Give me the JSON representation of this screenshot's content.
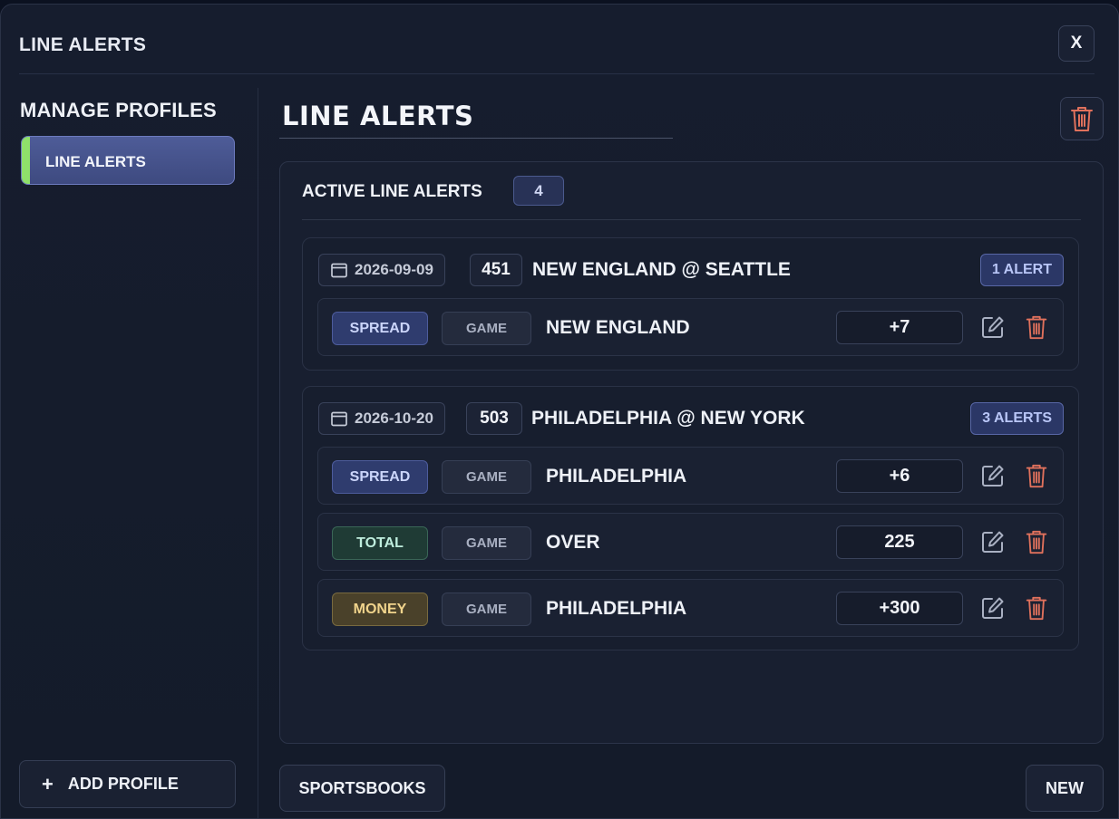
{
  "window": {
    "title": "LINE ALERTS",
    "close_label": "X"
  },
  "sidebar": {
    "title": "MANAGE PROFILES",
    "profiles": [
      {
        "label": "LINE ALERTS",
        "selected": true
      }
    ],
    "add_profile_label": "ADD PROFILE",
    "add_profile_icon": "+"
  },
  "main": {
    "profile_name": "LINE ALERTS",
    "panel": {
      "header_label": "ACTIVE LINE ALERTS",
      "active_count": "4"
    },
    "games": [
      {
        "date": "2026-09-09",
        "number": "451",
        "matchup": "NEW ENGLAND @ SEATTLE",
        "alert_count": "1 ALERT",
        "alerts": [
          {
            "type": "SPREAD",
            "scope": "GAME",
            "selection": "NEW ENGLAND",
            "line": "+7"
          }
        ]
      },
      {
        "date": "2026-10-20",
        "number": "503",
        "matchup": "PHILADELPHIA @ NEW YORK",
        "alert_count": "3 ALERTS",
        "alerts": [
          {
            "type": "SPREAD",
            "scope": "GAME",
            "selection": "PHILADELPHIA",
            "line": "+6"
          },
          {
            "type": "TOTAL",
            "scope": "GAME",
            "selection": "OVER",
            "line": "225"
          },
          {
            "type": "MONEY",
            "scope": "GAME",
            "selection": "PHILADELPHIA",
            "line": "+300"
          }
        ]
      }
    ],
    "sportsbooks_label": "SPORTSBOOKS",
    "new_label": "NEW"
  },
  "colors": {
    "accent_green": "#8fe06a",
    "trash_red": "#e0715c",
    "spread": "#2f3c6e",
    "total": "#1f3b35",
    "money": "#4a412a"
  }
}
